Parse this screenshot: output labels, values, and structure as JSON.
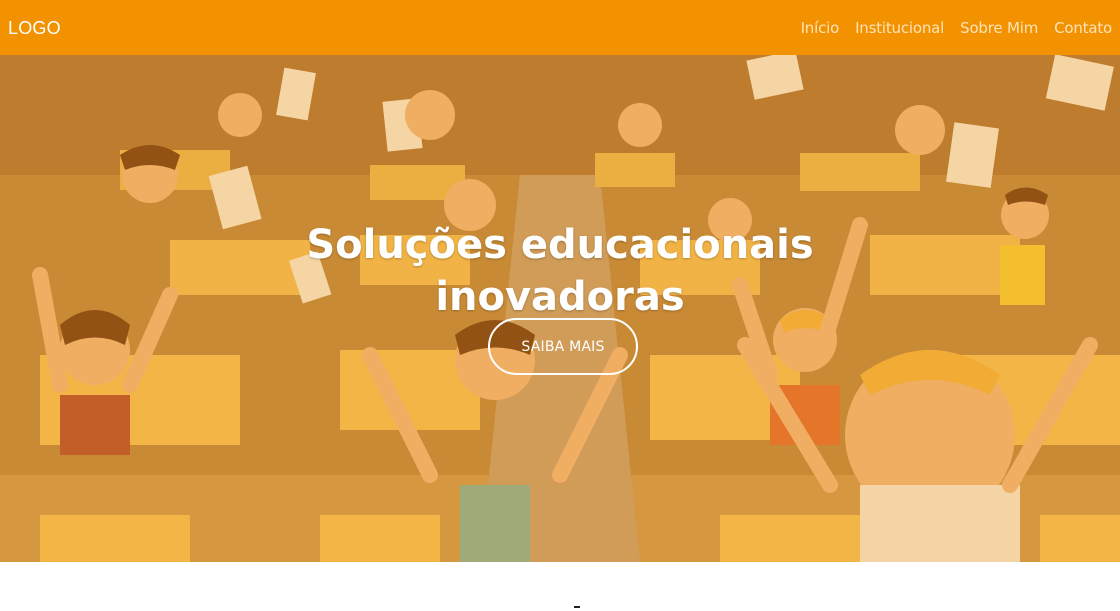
{
  "header": {
    "logo": "LOGO",
    "nav": [
      {
        "label": "Início"
      },
      {
        "label": "Institucional"
      },
      {
        "label": "Sobre Mim"
      },
      {
        "label": "Contato"
      }
    ]
  },
  "hero": {
    "title_line1": "Soluções educacionais",
    "title_line2": "inovadoras",
    "cta_label": "SAIBA MAIS",
    "background_image": "cartoon-classroom-celebration"
  },
  "colors": {
    "brand": "#f39200",
    "nav_link": "#ffe3b8",
    "text_on_brand": "#ffffff"
  }
}
